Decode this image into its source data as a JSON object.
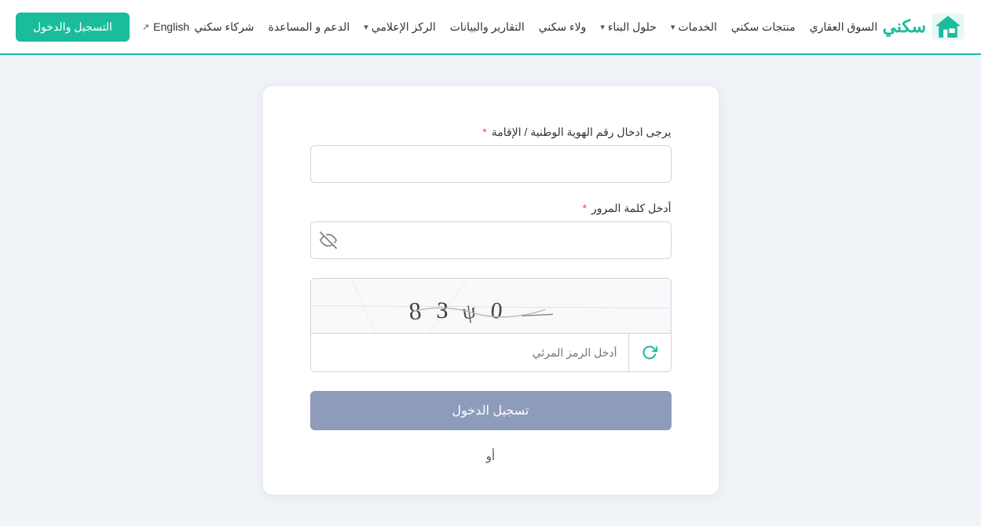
{
  "navbar": {
    "logo_text": "سكني",
    "nav_items": [
      {
        "id": "real-estate-market",
        "label": "السوق العقاري",
        "has_dropdown": false
      },
      {
        "id": "sakani-products",
        "label": "منتجات سكني",
        "has_dropdown": false
      },
      {
        "id": "services",
        "label": "الخدمات",
        "has_dropdown": true
      },
      {
        "id": "building-solutions",
        "label": "حلول البناء",
        "has_dropdown": true
      },
      {
        "id": "sakani-loyalty",
        "label": "ولاء سكني",
        "has_dropdown": false
      },
      {
        "id": "reports-data",
        "label": "التقارير والبيانات",
        "has_dropdown": false
      },
      {
        "id": "media-center",
        "label": "الركز الإعلامي",
        "has_dropdown": true
      },
      {
        "id": "support",
        "label": "الدعم و المساعدة",
        "has_dropdown": false
      },
      {
        "id": "sakani-partners",
        "label": "شركاء سكني",
        "has_dropdown": false
      }
    ],
    "english_label": "English",
    "register_login_label": "التسجيل والدخول"
  },
  "form": {
    "id_label": "يرجى ادخال رقم الهوية الوطنية / الإقامة",
    "id_required": "*",
    "id_placeholder": "",
    "password_label": "أدخل كلمة المرور",
    "password_required": "*",
    "password_placeholder": "",
    "captcha_input_placeholder": "أدخل الرمز المرئي",
    "submit_label": "تسجيل الدخول",
    "or_label": "أو"
  },
  "icons": {
    "eye_slash": "⊘",
    "refresh": "↻",
    "external_link": "↗"
  }
}
